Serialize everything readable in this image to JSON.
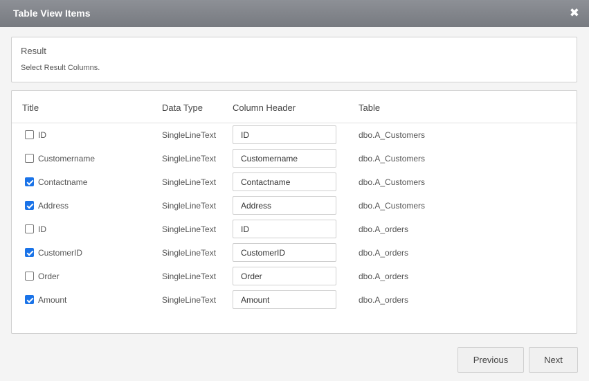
{
  "dialog": {
    "title": "Table View Items",
    "close_icon": "close-icon"
  },
  "result": {
    "heading": "Result",
    "description": "Select Result Columns."
  },
  "table": {
    "headers": {
      "title": "Title",
      "data_type": "Data Type",
      "column_header": "Column Header",
      "table": "Table"
    },
    "rows": [
      {
        "title": "ID",
        "checked": false,
        "data_type": "SingleLineText",
        "column_header": "ID",
        "table": "dbo.A_Customers"
      },
      {
        "title": "Customername",
        "checked": false,
        "data_type": "SingleLineText",
        "column_header": "Customername",
        "table": "dbo.A_Customers"
      },
      {
        "title": "Contactname",
        "checked": true,
        "data_type": "SingleLineText",
        "column_header": "Contactname",
        "table": "dbo.A_Customers"
      },
      {
        "title": "Address",
        "checked": true,
        "data_type": "SingleLineText",
        "column_header": "Address",
        "table": "dbo.A_Customers"
      },
      {
        "title": "ID",
        "checked": false,
        "data_type": "SingleLineText",
        "column_header": "ID",
        "table": "dbo.A_orders"
      },
      {
        "title": "CustomerID",
        "checked": true,
        "data_type": "SingleLineText",
        "column_header": "CustomerID",
        "table": "dbo.A_orders"
      },
      {
        "title": "Order",
        "checked": false,
        "data_type": "SingleLineText",
        "column_header": "Order",
        "table": "dbo.A_orders"
      },
      {
        "title": "Amount",
        "checked": true,
        "data_type": "SingleLineText",
        "column_header": "Amount",
        "table": "dbo.A_orders"
      }
    ]
  },
  "footer": {
    "previous_label": "Previous",
    "next_label": "Next"
  },
  "colors": {
    "titlebar": "#80838a",
    "checkbox_checked": "#1a73e8"
  }
}
